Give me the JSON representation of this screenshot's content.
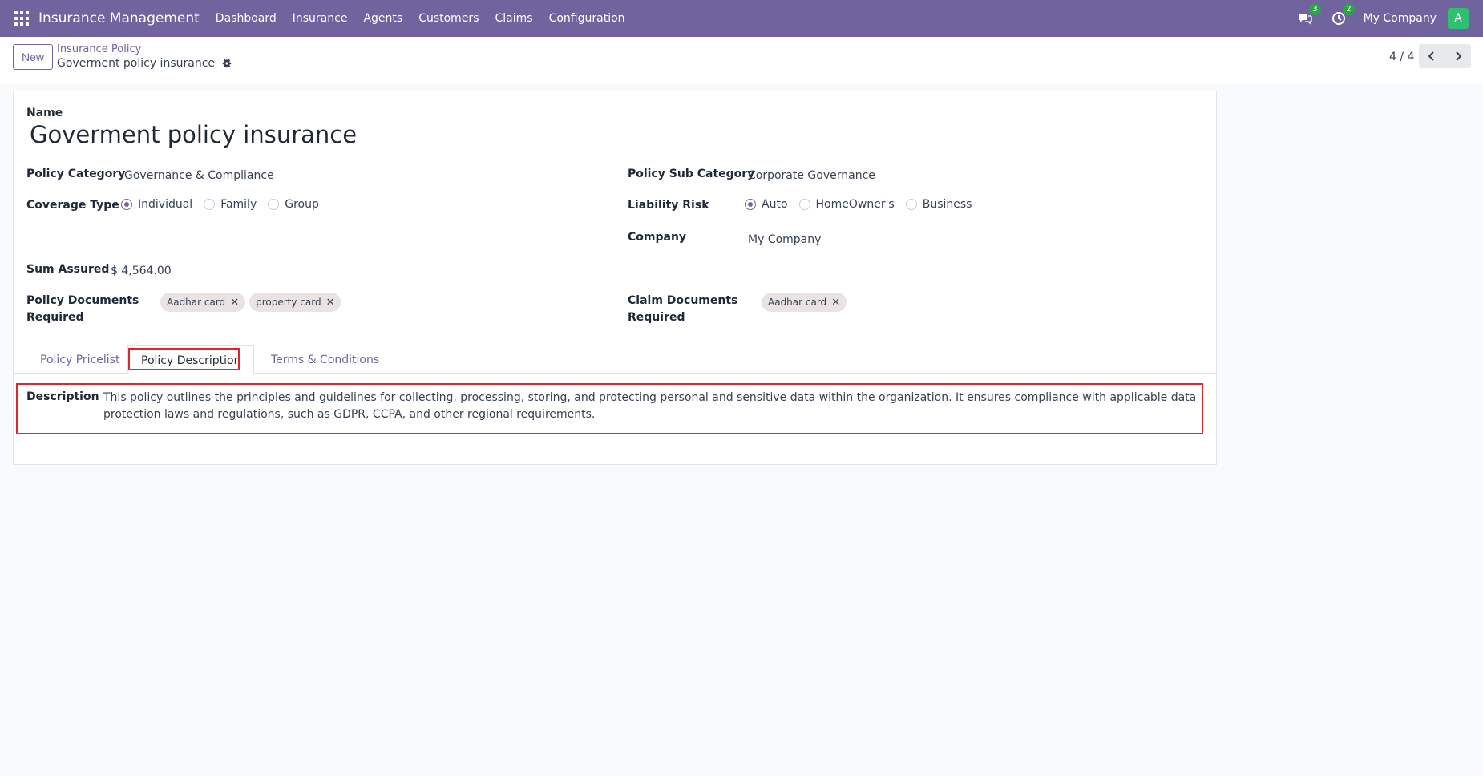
{
  "navbar": {
    "brand": "Insurance Management",
    "menu": [
      "Dashboard",
      "Insurance",
      "Agents",
      "Customers",
      "Claims",
      "Configuration"
    ],
    "messages_count": "3",
    "activities_count": "2",
    "company": "My Company",
    "avatar_initial": "A"
  },
  "control": {
    "new_label": "New",
    "breadcrumb_parent": "Insurance Policy",
    "breadcrumb_current": "Goverment policy insurance",
    "pager": "4 / 4"
  },
  "form": {
    "name_label": "Name",
    "name_value": "Goverment policy insurance",
    "policy_category_label": "Policy Category",
    "policy_category_value": "Governance & Compliance",
    "policy_sub_category_label": "Policy Sub Category",
    "policy_sub_category_value": "Corporate Governance",
    "coverage_type_label": "Coverage Type",
    "coverage_options": [
      "Individual",
      "Family",
      "Group"
    ],
    "coverage_selected": "Individual",
    "liability_risk_label": "Liability Risk",
    "liability_options": [
      "Auto",
      "HomeOwner's",
      "Business"
    ],
    "liability_selected": "Auto",
    "company_label": "Company",
    "company_value": "My Company",
    "sum_assured_label": "Sum Assured",
    "sum_assured_value": "$ 4,564.00",
    "policy_docs_label_1": "Policy Documents",
    "policy_docs_label_2": "Required",
    "policy_docs": [
      "Aadhar card",
      "property card"
    ],
    "claim_docs_label_1": "Claim Documents",
    "claim_docs_label_2": "Required",
    "claim_docs": [
      "Aadhar card"
    ]
  },
  "tabs": [
    "Policy Pricelist",
    "Policy Description",
    "Terms & Conditions"
  ],
  "active_tab": "Policy Description",
  "description": {
    "label": "Description",
    "text": "This policy outlines the principles and guidelines for collecting, processing, storing, and protecting personal and sensitive data within the organization. It ensures compliance with applicable data protection laws and regulations, such as GDPR, CCPA, and other regional requirements."
  },
  "colors": {
    "brand": "#71639e",
    "highlight": "#e3242b",
    "badge": "#28a745",
    "avatar": "#2fbf71"
  },
  "icons": [
    "apps-grid-icon",
    "chat-icon",
    "activity-clock-icon",
    "gear-icon",
    "chevron-left-icon",
    "chevron-right-icon",
    "close-icon"
  ]
}
